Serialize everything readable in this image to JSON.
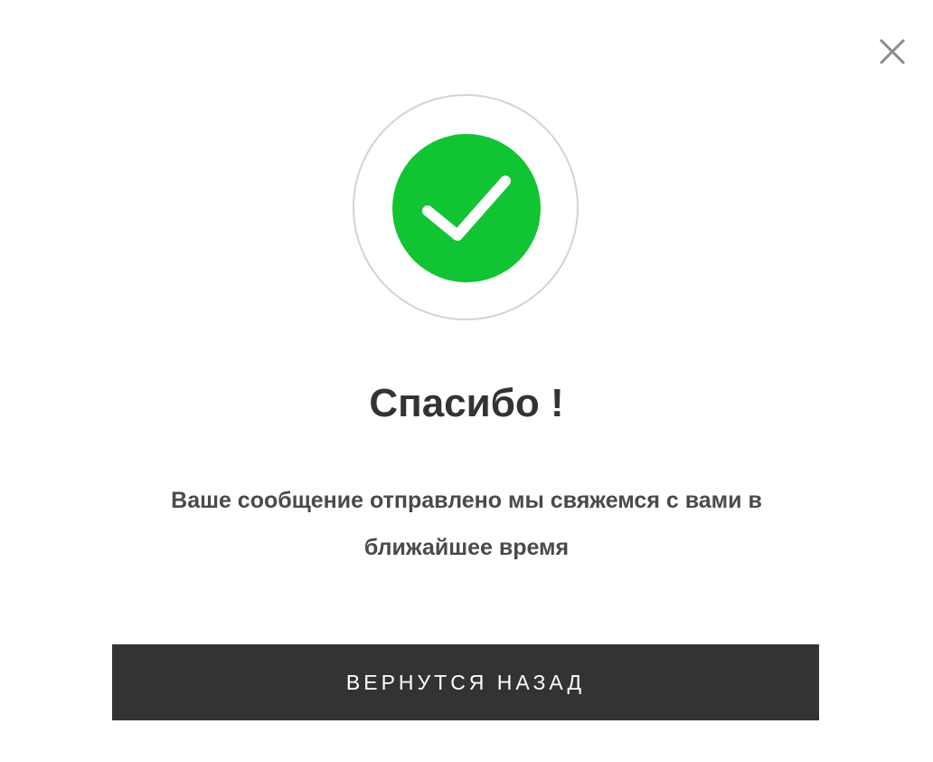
{
  "modal": {
    "close_icon": "close-icon",
    "success_icon": "checkmark-icon",
    "title": "Спасибо !",
    "message": "Ваше сообщение отправлено мы свяжемся с вами в ближайшее время",
    "back_button_label": "ВЕРНУТСЯ НАЗАД"
  },
  "colors": {
    "success_green": "#10c433",
    "button_bg": "#333333",
    "close_icon": "#8a8a8a",
    "ring_border": "#d3d3d3"
  }
}
